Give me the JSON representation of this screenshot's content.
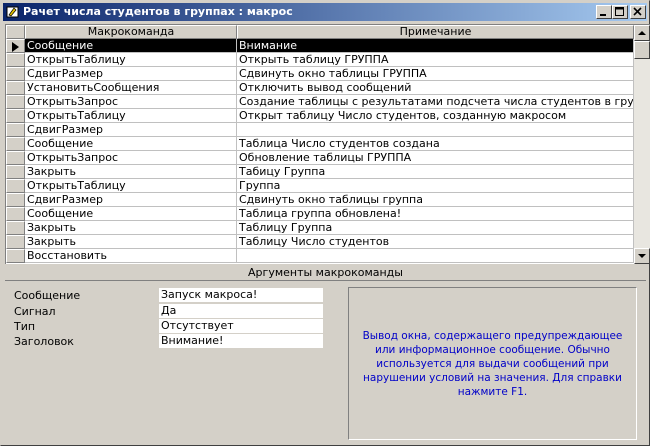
{
  "window": {
    "title": "Рачет числа студентов в группах : макрос",
    "icon": "macro-icon",
    "controls": [
      "minimize-icon",
      "maximize-icon",
      "close-icon"
    ]
  },
  "grid": {
    "headers": {
      "command": "Макрокоманда",
      "note": "Примечание"
    },
    "rows": [
      {
        "command": "Сообщение",
        "note": "Внимание"
      },
      {
        "command": "ОткрытьТаблицу",
        "note": "Открыть таблицу ГРУППА"
      },
      {
        "command": "СдвигРазмер",
        "note": "Сдвинуть окно таблицы ГРУППА"
      },
      {
        "command": "УстановитьСообщения",
        "note": "Отключить вывод сообщений"
      },
      {
        "command": "ОткрытьЗапрос",
        "note": "Создание таблицы с результатами подсчета числа студентов в группе"
      },
      {
        "command": "ОткрытьТаблицу",
        "note": "Открыт таблицу Число студентов, созданную макросом"
      },
      {
        "command": "СдвигРазмер",
        "note": ""
      },
      {
        "command": "Сообщение",
        "note": "Таблица Число студентов создана"
      },
      {
        "command": "ОткрытьЗапрос",
        "note": "Обновление таблицы ГРУППА"
      },
      {
        "command": "Закрыть",
        "note": "Табицу Группа"
      },
      {
        "command": "ОткрытьТаблицу",
        "note": "Группа"
      },
      {
        "command": "СдвигРазмер",
        "note": "Сдвинуть окно таблицы группа"
      },
      {
        "command": "Сообщение",
        "note": "Таблица группа обновлена!"
      },
      {
        "command": "Закрыть",
        "note": "Таблицу Группа"
      },
      {
        "command": "Закрыть",
        "note": "Таблицу Число студентов"
      },
      {
        "command": "Восстановить",
        "note": ""
      }
    ]
  },
  "arguments": {
    "header": "Аргументы макрокоманды",
    "items": [
      {
        "label": "Сообщение",
        "value": "Запуск макроса!"
      },
      {
        "label": "Сигнал",
        "value": "Да"
      },
      {
        "label": "Тип",
        "value": "Отсутствует"
      },
      {
        "label": "Заголовок",
        "value": "Внимание!"
      }
    ]
  },
  "help": {
    "text": "Вывод окна, содержащего предупреждающее или информационное сообщение. Обычно используется для выдачи сообщений при нарушении условий на значения. Для справки нажмите F1."
  },
  "colors": {
    "title_start": "#0a246a",
    "title_end": "#a6caf0",
    "help_text": "#0000c8",
    "selection": "#000000"
  }
}
